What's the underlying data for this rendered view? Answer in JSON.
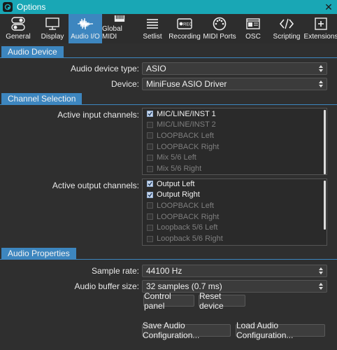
{
  "window": {
    "title": "Options",
    "close_glyph": "✕"
  },
  "toolbar": {
    "tabs": [
      {
        "label": "General",
        "icon": "toggles-icon"
      },
      {
        "label": "Display",
        "icon": "monitor-icon"
      },
      {
        "label": "Audio I/O",
        "icon": "waveform-icon",
        "active": true
      },
      {
        "label": "Global MIDI",
        "icon": "piano-icon"
      },
      {
        "label": "Setlist",
        "icon": "list-icon"
      },
      {
        "label": "Recording",
        "icon": "rec-icon"
      },
      {
        "label": "MIDI Ports",
        "icon": "midi-port-icon"
      },
      {
        "label": "OSC",
        "icon": "osc-icon"
      },
      {
        "label": "Scripting",
        "icon": "code-icon"
      },
      {
        "label": "Extensions",
        "icon": "plus-box-icon"
      }
    ],
    "rec_badge": "REC"
  },
  "audio_device": {
    "header": "Audio Device",
    "type_label": "Audio device type:",
    "type_value": "ASIO",
    "device_label": "Device:",
    "device_value": "MiniFuse ASIO Driver"
  },
  "channel_selection": {
    "header": "Channel Selection",
    "input_label": "Active input channels:",
    "inputs": [
      {
        "label": "MIC/LINE/INST 1",
        "checked": true
      },
      {
        "label": "MIC/LINE/INST 2",
        "checked": false
      },
      {
        "label": "LOOPBACK Left",
        "checked": false
      },
      {
        "label": "LOOPBACK Right",
        "checked": false
      },
      {
        "label": "Mix 5/6 Left",
        "checked": false
      },
      {
        "label": "Mix 5/6 Right",
        "checked": false
      }
    ],
    "output_label": "Active output channels:",
    "outputs": [
      {
        "label": "Output Left",
        "checked": true
      },
      {
        "label": "Output Right",
        "checked": true
      },
      {
        "label": "LOOPBACK Left",
        "checked": false
      },
      {
        "label": "LOOPBACK Right",
        "checked": false
      },
      {
        "label": "Loopback 5/6 Left",
        "checked": false
      },
      {
        "label": "Loopback 5/6 Right",
        "checked": false
      }
    ]
  },
  "audio_properties": {
    "header": "Audio Properties",
    "sample_rate_label": "Sample rate:",
    "sample_rate_value": "44100 Hz",
    "buffer_label": "Audio buffer size:",
    "buffer_value": "32 samples (0.7 ms)",
    "control_panel": "Control panel",
    "reset_device": "Reset device"
  },
  "footer": {
    "save": "Save Audio Configuration...",
    "load": "Load Audio Configuration..."
  },
  "colors": {
    "titlebar": "#19a7b5",
    "accent": "#3d86bf",
    "background": "#2f2f2f"
  }
}
